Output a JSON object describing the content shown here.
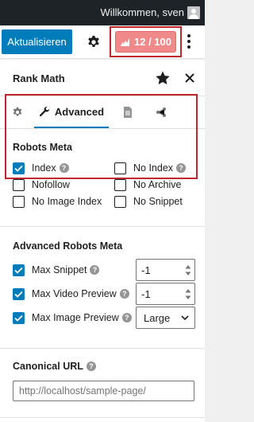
{
  "admin_bar": {
    "greeting": "Willkommen, sven"
  },
  "toolbar": {
    "update_label": "Aktualisieren",
    "score_label": "12 / 100"
  },
  "panel": {
    "title": "Rank Math",
    "tabs": [
      {
        "label": "",
        "icon": "gear-icon"
      },
      {
        "label": "Advanced",
        "icon": "wrench-icon"
      },
      {
        "label": "",
        "icon": "document-icon"
      },
      {
        "label": "",
        "icon": "share-icon"
      }
    ]
  },
  "robots_meta": {
    "title": "Robots Meta",
    "options": [
      {
        "label": "Index",
        "checked": true
      },
      {
        "label": "No Index",
        "checked": false
      },
      {
        "label": "Nofollow",
        "checked": false
      },
      {
        "label": "No Archive",
        "checked": false
      },
      {
        "label": "No Image Index",
        "checked": false
      },
      {
        "label": "No Snippet",
        "checked": false
      }
    ]
  },
  "advanced_robots": {
    "title": "Advanced Robots Meta",
    "rows": [
      {
        "label": "Max Snippet",
        "checked": true,
        "value": "-1"
      },
      {
        "label": "Max Video Preview",
        "checked": true,
        "value": "-1"
      },
      {
        "label": "Max Image Preview",
        "checked": true,
        "value": "Large"
      }
    ]
  },
  "canonical": {
    "title": "Canonical URL",
    "placeholder": "http://localhost/sample-page/"
  },
  "help_glyph": "?",
  "colors": {
    "primary": "#007cba",
    "score_bg": "#f08a8a",
    "highlight": "#c0262d",
    "admin_bar": "#1d2327"
  }
}
